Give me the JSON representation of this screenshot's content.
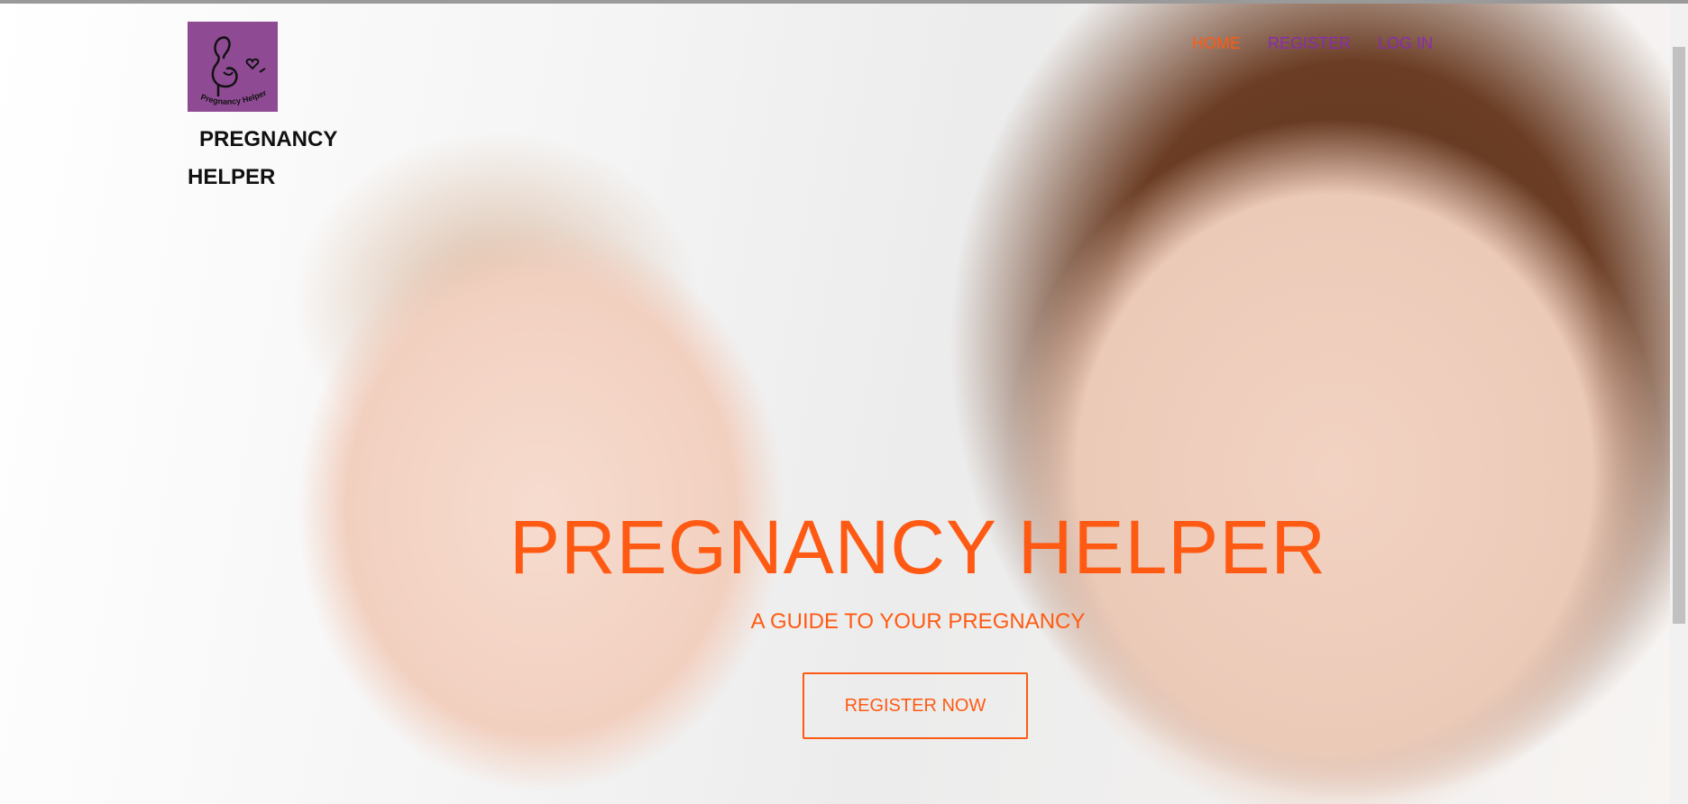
{
  "brand": {
    "name_line1": "PREGNANCY",
    "name_line2": "HELPER",
    "logo_text": "Pregnancy Helper",
    "logo_color": "#8e4b93"
  },
  "nav": {
    "items": [
      {
        "label": "HOME",
        "color": "#ff5a13"
      },
      {
        "label": "REGISTER",
        "color": "#8a2bb0"
      },
      {
        "label": "LOG IN",
        "color": "#8a2bb0"
      }
    ]
  },
  "hero": {
    "title": "PREGNANCY HELPER",
    "subtitle": "A GUIDE TO YOUR PREGNANCY",
    "cta_label": "REGISTER NOW",
    "accent_color": "#ff5a13",
    "image_icon": "mother-and-baby-photo"
  }
}
